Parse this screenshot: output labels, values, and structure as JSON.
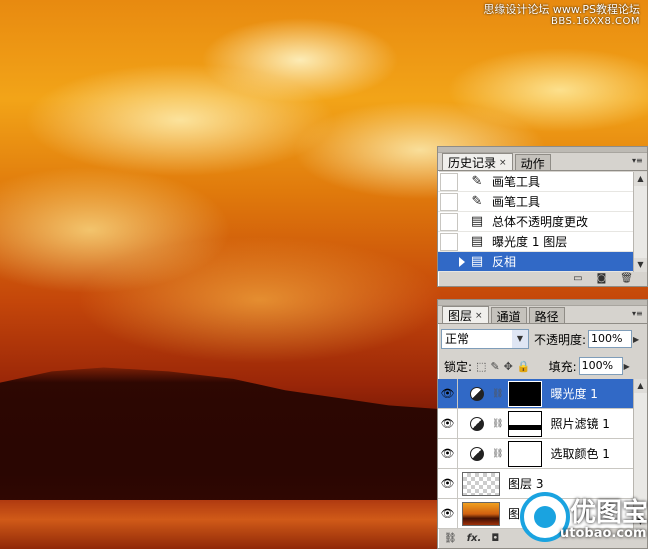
{
  "watermark_top": {
    "line1": "思缘设计论坛 www.PS教程论坛",
    "line2": "BBS.16XX8.COM"
  },
  "watermark_bottom": {
    "title": "优图宝",
    "subtitle": "utobao.com"
  },
  "history_panel": {
    "tabs": [
      {
        "label": "历史记录",
        "close": "×"
      },
      {
        "label": "动作"
      }
    ],
    "menu_icon": "panel-menu-icon",
    "items": [
      {
        "label": "画笔工具",
        "icon": "brush-icon"
      },
      {
        "label": "画笔工具",
        "icon": "brush-icon"
      },
      {
        "label": "总体不透明度更改",
        "icon": "history-state-icon"
      },
      {
        "label": "曝光度 1 图层",
        "icon": "history-state-icon"
      },
      {
        "label": "反相",
        "icon": "history-state-icon",
        "selected": true
      }
    ],
    "footer_icons": [
      "new-document-from-state-icon",
      "snapshot-icon",
      "delete-icon"
    ]
  },
  "layers_panel": {
    "tabs": [
      {
        "label": "图层",
        "close": "×"
      },
      {
        "label": "通道"
      },
      {
        "label": "路径"
      }
    ],
    "blend_mode": "正常",
    "opacity_label": "不透明度:",
    "opacity_value": "100%",
    "lock_label": "锁定:",
    "fill_label": "填充:",
    "fill_value": "100%",
    "layers": [
      {
        "name": "曝光度 1",
        "type": "adjustment",
        "mask": "black",
        "selected": true
      },
      {
        "name": "照片滤镜 1",
        "type": "adjustment",
        "mask": "white-with-black"
      },
      {
        "name": "选取颜色 1",
        "type": "adjustment",
        "mask": "white"
      },
      {
        "name": "图层 3",
        "type": "pixel",
        "thumb": "transparent"
      },
      {
        "name": "图层",
        "type": "pixel",
        "thumb": "photo"
      }
    ],
    "footer_icons": [
      "link-layers-icon",
      "fx-icon",
      "add-mask-icon"
    ]
  },
  "colors": {
    "selection": "#3169c6",
    "panel_bg": "#d6d3ce",
    "sky_orange": "#f2a418",
    "dark_land": "#2a0602"
  }
}
